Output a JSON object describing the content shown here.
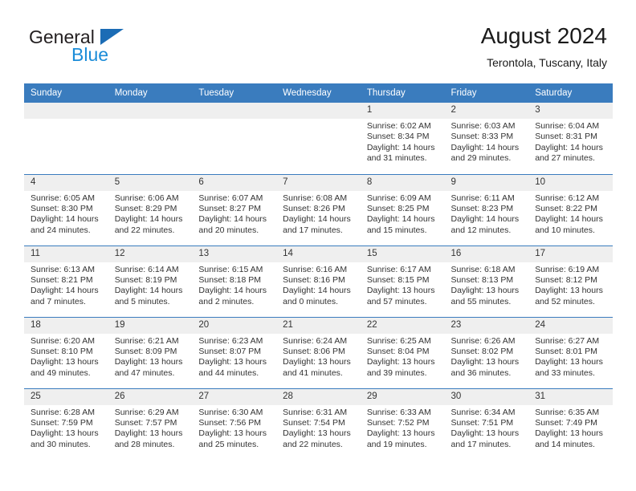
{
  "brand": {
    "name_top": "General",
    "name_bottom": "Blue",
    "accent_color": "#1b8cd8",
    "triangle_color": "#1b6cb5"
  },
  "header": {
    "title": "August 2024",
    "subtitle": "Terontola, Tuscany, Italy",
    "header_bg": "#3a7cbe",
    "daynum_bg": "#efefef"
  },
  "weekdays": [
    "Sunday",
    "Monday",
    "Tuesday",
    "Wednesday",
    "Thursday",
    "Friday",
    "Saturday"
  ],
  "labels": {
    "sunrise": "Sunrise:",
    "sunset": "Sunset:",
    "daylight": "Daylight:"
  },
  "weeks": [
    [
      {
        "day": "",
        "empty": true
      },
      {
        "day": "",
        "empty": true
      },
      {
        "day": "",
        "empty": true
      },
      {
        "day": "",
        "empty": true
      },
      {
        "day": "1",
        "sunrise": "Sunrise: 6:02 AM",
        "sunset": "Sunset: 8:34 PM",
        "daylight1": "Daylight: 14 hours",
        "daylight2": "and 31 minutes."
      },
      {
        "day": "2",
        "sunrise": "Sunrise: 6:03 AM",
        "sunset": "Sunset: 8:33 PM",
        "daylight1": "Daylight: 14 hours",
        "daylight2": "and 29 minutes."
      },
      {
        "day": "3",
        "sunrise": "Sunrise: 6:04 AM",
        "sunset": "Sunset: 8:31 PM",
        "daylight1": "Daylight: 14 hours",
        "daylight2": "and 27 minutes."
      }
    ],
    [
      {
        "day": "4",
        "sunrise": "Sunrise: 6:05 AM",
        "sunset": "Sunset: 8:30 PM",
        "daylight1": "Daylight: 14 hours",
        "daylight2": "and 24 minutes."
      },
      {
        "day": "5",
        "sunrise": "Sunrise: 6:06 AM",
        "sunset": "Sunset: 8:29 PM",
        "daylight1": "Daylight: 14 hours",
        "daylight2": "and 22 minutes."
      },
      {
        "day": "6",
        "sunrise": "Sunrise: 6:07 AM",
        "sunset": "Sunset: 8:27 PM",
        "daylight1": "Daylight: 14 hours",
        "daylight2": "and 20 minutes."
      },
      {
        "day": "7",
        "sunrise": "Sunrise: 6:08 AM",
        "sunset": "Sunset: 8:26 PM",
        "daylight1": "Daylight: 14 hours",
        "daylight2": "and 17 minutes."
      },
      {
        "day": "8",
        "sunrise": "Sunrise: 6:09 AM",
        "sunset": "Sunset: 8:25 PM",
        "daylight1": "Daylight: 14 hours",
        "daylight2": "and 15 minutes."
      },
      {
        "day": "9",
        "sunrise": "Sunrise: 6:11 AM",
        "sunset": "Sunset: 8:23 PM",
        "daylight1": "Daylight: 14 hours",
        "daylight2": "and 12 minutes."
      },
      {
        "day": "10",
        "sunrise": "Sunrise: 6:12 AM",
        "sunset": "Sunset: 8:22 PM",
        "daylight1": "Daylight: 14 hours",
        "daylight2": "and 10 minutes."
      }
    ],
    [
      {
        "day": "11",
        "sunrise": "Sunrise: 6:13 AM",
        "sunset": "Sunset: 8:21 PM",
        "daylight1": "Daylight: 14 hours",
        "daylight2": "and 7 minutes."
      },
      {
        "day": "12",
        "sunrise": "Sunrise: 6:14 AM",
        "sunset": "Sunset: 8:19 PM",
        "daylight1": "Daylight: 14 hours",
        "daylight2": "and 5 minutes."
      },
      {
        "day": "13",
        "sunrise": "Sunrise: 6:15 AM",
        "sunset": "Sunset: 8:18 PM",
        "daylight1": "Daylight: 14 hours",
        "daylight2": "and 2 minutes."
      },
      {
        "day": "14",
        "sunrise": "Sunrise: 6:16 AM",
        "sunset": "Sunset: 8:16 PM",
        "daylight1": "Daylight: 14 hours",
        "daylight2": "and 0 minutes."
      },
      {
        "day": "15",
        "sunrise": "Sunrise: 6:17 AM",
        "sunset": "Sunset: 8:15 PM",
        "daylight1": "Daylight: 13 hours",
        "daylight2": "and 57 minutes."
      },
      {
        "day": "16",
        "sunrise": "Sunrise: 6:18 AM",
        "sunset": "Sunset: 8:13 PM",
        "daylight1": "Daylight: 13 hours",
        "daylight2": "and 55 minutes."
      },
      {
        "day": "17",
        "sunrise": "Sunrise: 6:19 AM",
        "sunset": "Sunset: 8:12 PM",
        "daylight1": "Daylight: 13 hours",
        "daylight2": "and 52 minutes."
      }
    ],
    [
      {
        "day": "18",
        "sunrise": "Sunrise: 6:20 AM",
        "sunset": "Sunset: 8:10 PM",
        "daylight1": "Daylight: 13 hours",
        "daylight2": "and 49 minutes."
      },
      {
        "day": "19",
        "sunrise": "Sunrise: 6:21 AM",
        "sunset": "Sunset: 8:09 PM",
        "daylight1": "Daylight: 13 hours",
        "daylight2": "and 47 minutes."
      },
      {
        "day": "20",
        "sunrise": "Sunrise: 6:23 AM",
        "sunset": "Sunset: 8:07 PM",
        "daylight1": "Daylight: 13 hours",
        "daylight2": "and 44 minutes."
      },
      {
        "day": "21",
        "sunrise": "Sunrise: 6:24 AM",
        "sunset": "Sunset: 8:06 PM",
        "daylight1": "Daylight: 13 hours",
        "daylight2": "and 41 minutes."
      },
      {
        "day": "22",
        "sunrise": "Sunrise: 6:25 AM",
        "sunset": "Sunset: 8:04 PM",
        "daylight1": "Daylight: 13 hours",
        "daylight2": "and 39 minutes."
      },
      {
        "day": "23",
        "sunrise": "Sunrise: 6:26 AM",
        "sunset": "Sunset: 8:02 PM",
        "daylight1": "Daylight: 13 hours",
        "daylight2": "and 36 minutes."
      },
      {
        "day": "24",
        "sunrise": "Sunrise: 6:27 AM",
        "sunset": "Sunset: 8:01 PM",
        "daylight1": "Daylight: 13 hours",
        "daylight2": "and 33 minutes."
      }
    ],
    [
      {
        "day": "25",
        "sunrise": "Sunrise: 6:28 AM",
        "sunset": "Sunset: 7:59 PM",
        "daylight1": "Daylight: 13 hours",
        "daylight2": "and 30 minutes."
      },
      {
        "day": "26",
        "sunrise": "Sunrise: 6:29 AM",
        "sunset": "Sunset: 7:57 PM",
        "daylight1": "Daylight: 13 hours",
        "daylight2": "and 28 minutes."
      },
      {
        "day": "27",
        "sunrise": "Sunrise: 6:30 AM",
        "sunset": "Sunset: 7:56 PM",
        "daylight1": "Daylight: 13 hours",
        "daylight2": "and 25 minutes."
      },
      {
        "day": "28",
        "sunrise": "Sunrise: 6:31 AM",
        "sunset": "Sunset: 7:54 PM",
        "daylight1": "Daylight: 13 hours",
        "daylight2": "and 22 minutes."
      },
      {
        "day": "29",
        "sunrise": "Sunrise: 6:33 AM",
        "sunset": "Sunset: 7:52 PM",
        "daylight1": "Daylight: 13 hours",
        "daylight2": "and 19 minutes."
      },
      {
        "day": "30",
        "sunrise": "Sunrise: 6:34 AM",
        "sunset": "Sunset: 7:51 PM",
        "daylight1": "Daylight: 13 hours",
        "daylight2": "and 17 minutes."
      },
      {
        "day": "31",
        "sunrise": "Sunrise: 6:35 AM",
        "sunset": "Sunset: 7:49 PM",
        "daylight1": "Daylight: 13 hours",
        "daylight2": "and 14 minutes."
      }
    ]
  ]
}
